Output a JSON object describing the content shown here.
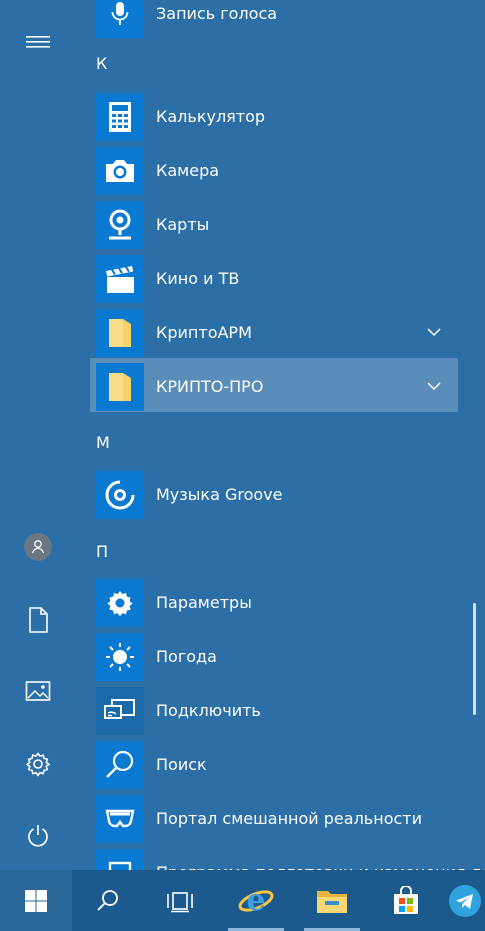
{
  "rail": {
    "items": [
      {
        "name": "menu-icon"
      },
      {
        "name": "user-icon"
      },
      {
        "name": "documents-icon"
      },
      {
        "name": "pictures-icon"
      },
      {
        "name": "settings-icon"
      },
      {
        "name": "power-icon"
      }
    ]
  },
  "apps": {
    "voice_recorder": "Запись голоса",
    "letter_k": "К",
    "calculator": "Калькулятор",
    "camera": "Камера",
    "maps": "Карты",
    "movies_tv": "Кино и ТВ",
    "cryptoarm": "КриптоАРМ",
    "cryptopro": "КРИПТО-ПРО",
    "letter_m": "М",
    "groove": "Музыка Groove",
    "letter_p": "П",
    "settings": "Параметры",
    "weather": "Погода",
    "connect": "Подключить",
    "search": "Поиск",
    "mixed_reality": "Портал смешанной реальности",
    "partial_item": "Программа подготовки и изменения документов"
  },
  "taskbar": {
    "items": [
      "windows-start-icon",
      "search-icon",
      "task-view-icon",
      "internet-explorer-icon",
      "file-explorer-icon",
      "store-icon",
      "telegram-icon"
    ]
  },
  "colors": {
    "background": "#2c6ea6",
    "tile": "#0a79d2",
    "taskbar": "#1c5a8e",
    "folder": "#f5d26b"
  }
}
